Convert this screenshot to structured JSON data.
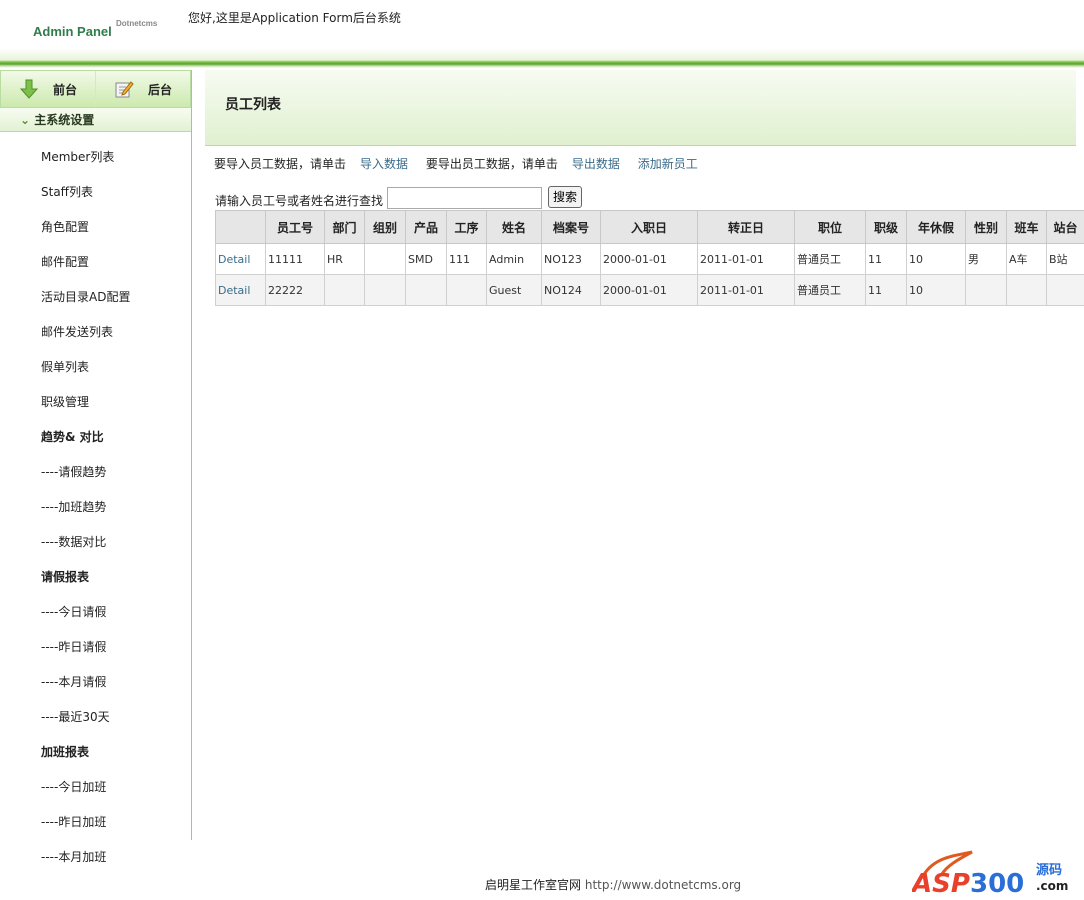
{
  "header": {
    "logo": "Admin Panel",
    "logo_sup": "Dotnetcms",
    "welcome": "您好,这里是Application Form后台系统"
  },
  "sidebar": {
    "tabs": [
      {
        "label": "前台",
        "icon": "arrow-down-icon"
      },
      {
        "label": "后台",
        "icon": "edit-icon"
      }
    ],
    "section": "主系统设置",
    "items": [
      {
        "label": "Member列表",
        "bold": false
      },
      {
        "label": "Staff列表",
        "bold": false
      },
      {
        "label": "角色配置",
        "bold": false
      },
      {
        "label": "邮件配置",
        "bold": false
      },
      {
        "label": "活动目录AD配置",
        "bold": false
      },
      {
        "label": "邮件发送列表",
        "bold": false
      },
      {
        "label": "假单列表",
        "bold": false
      },
      {
        "label": "职级管理",
        "bold": false
      },
      {
        "label": "趋势& 对比",
        "bold": true
      },
      {
        "label": "----请假趋势",
        "bold": false
      },
      {
        "label": "----加班趋势",
        "bold": false
      },
      {
        "label": "----数据对比",
        "bold": false
      },
      {
        "label": "请假报表",
        "bold": true
      },
      {
        "label": "----今日请假",
        "bold": false
      },
      {
        "label": "----昨日请假",
        "bold": false
      },
      {
        "label": "----本月请假",
        "bold": false
      },
      {
        "label": "----最近30天",
        "bold": false
      },
      {
        "label": "加班报表",
        "bold": true
      },
      {
        "label": "----今日加班",
        "bold": false
      },
      {
        "label": "----昨日加班",
        "bold": false
      },
      {
        "label": "----本月加班",
        "bold": false
      }
    ]
  },
  "main": {
    "title": "员工列表",
    "import_text": "要导入员工数据，请单击",
    "import_link": "导入数据",
    "export_text": "要导出员工数据，请单击",
    "export_link": "导出数据",
    "add_link": "添加新员工",
    "search_label": "请输入员工号或者姓名进行查找",
    "search_value": "",
    "search_button": "搜索",
    "columns": [
      "",
      "员工号",
      "部门",
      "组别",
      "产品",
      "工序",
      "姓名",
      "档案号",
      "入职日",
      "转正日",
      "职位",
      "职级",
      "年休假",
      "性别",
      "班车",
      "站台"
    ],
    "rows": [
      [
        "Detail",
        "11111",
        "HR",
        "",
        "SMD",
        "111",
        "Admin",
        "NO123",
        "2000-01-01",
        "2011-01-01",
        "普通员工",
        "11",
        "10",
        "男",
        "A车",
        "B站"
      ],
      [
        "Detail",
        "22222",
        "",
        "",
        "",
        "",
        "Guest",
        "NO124",
        "2000-01-01",
        "2011-01-01",
        "普通员工",
        "11",
        "10",
        "",
        "",
        ""
      ]
    ]
  },
  "footer": {
    "text": "启明星工作室官网",
    "url": "http://www.dotnetcms.org",
    "badge": "ASP300源码.com"
  },
  "colors": {
    "accent": "#5aa332",
    "link": "#386c8a"
  }
}
